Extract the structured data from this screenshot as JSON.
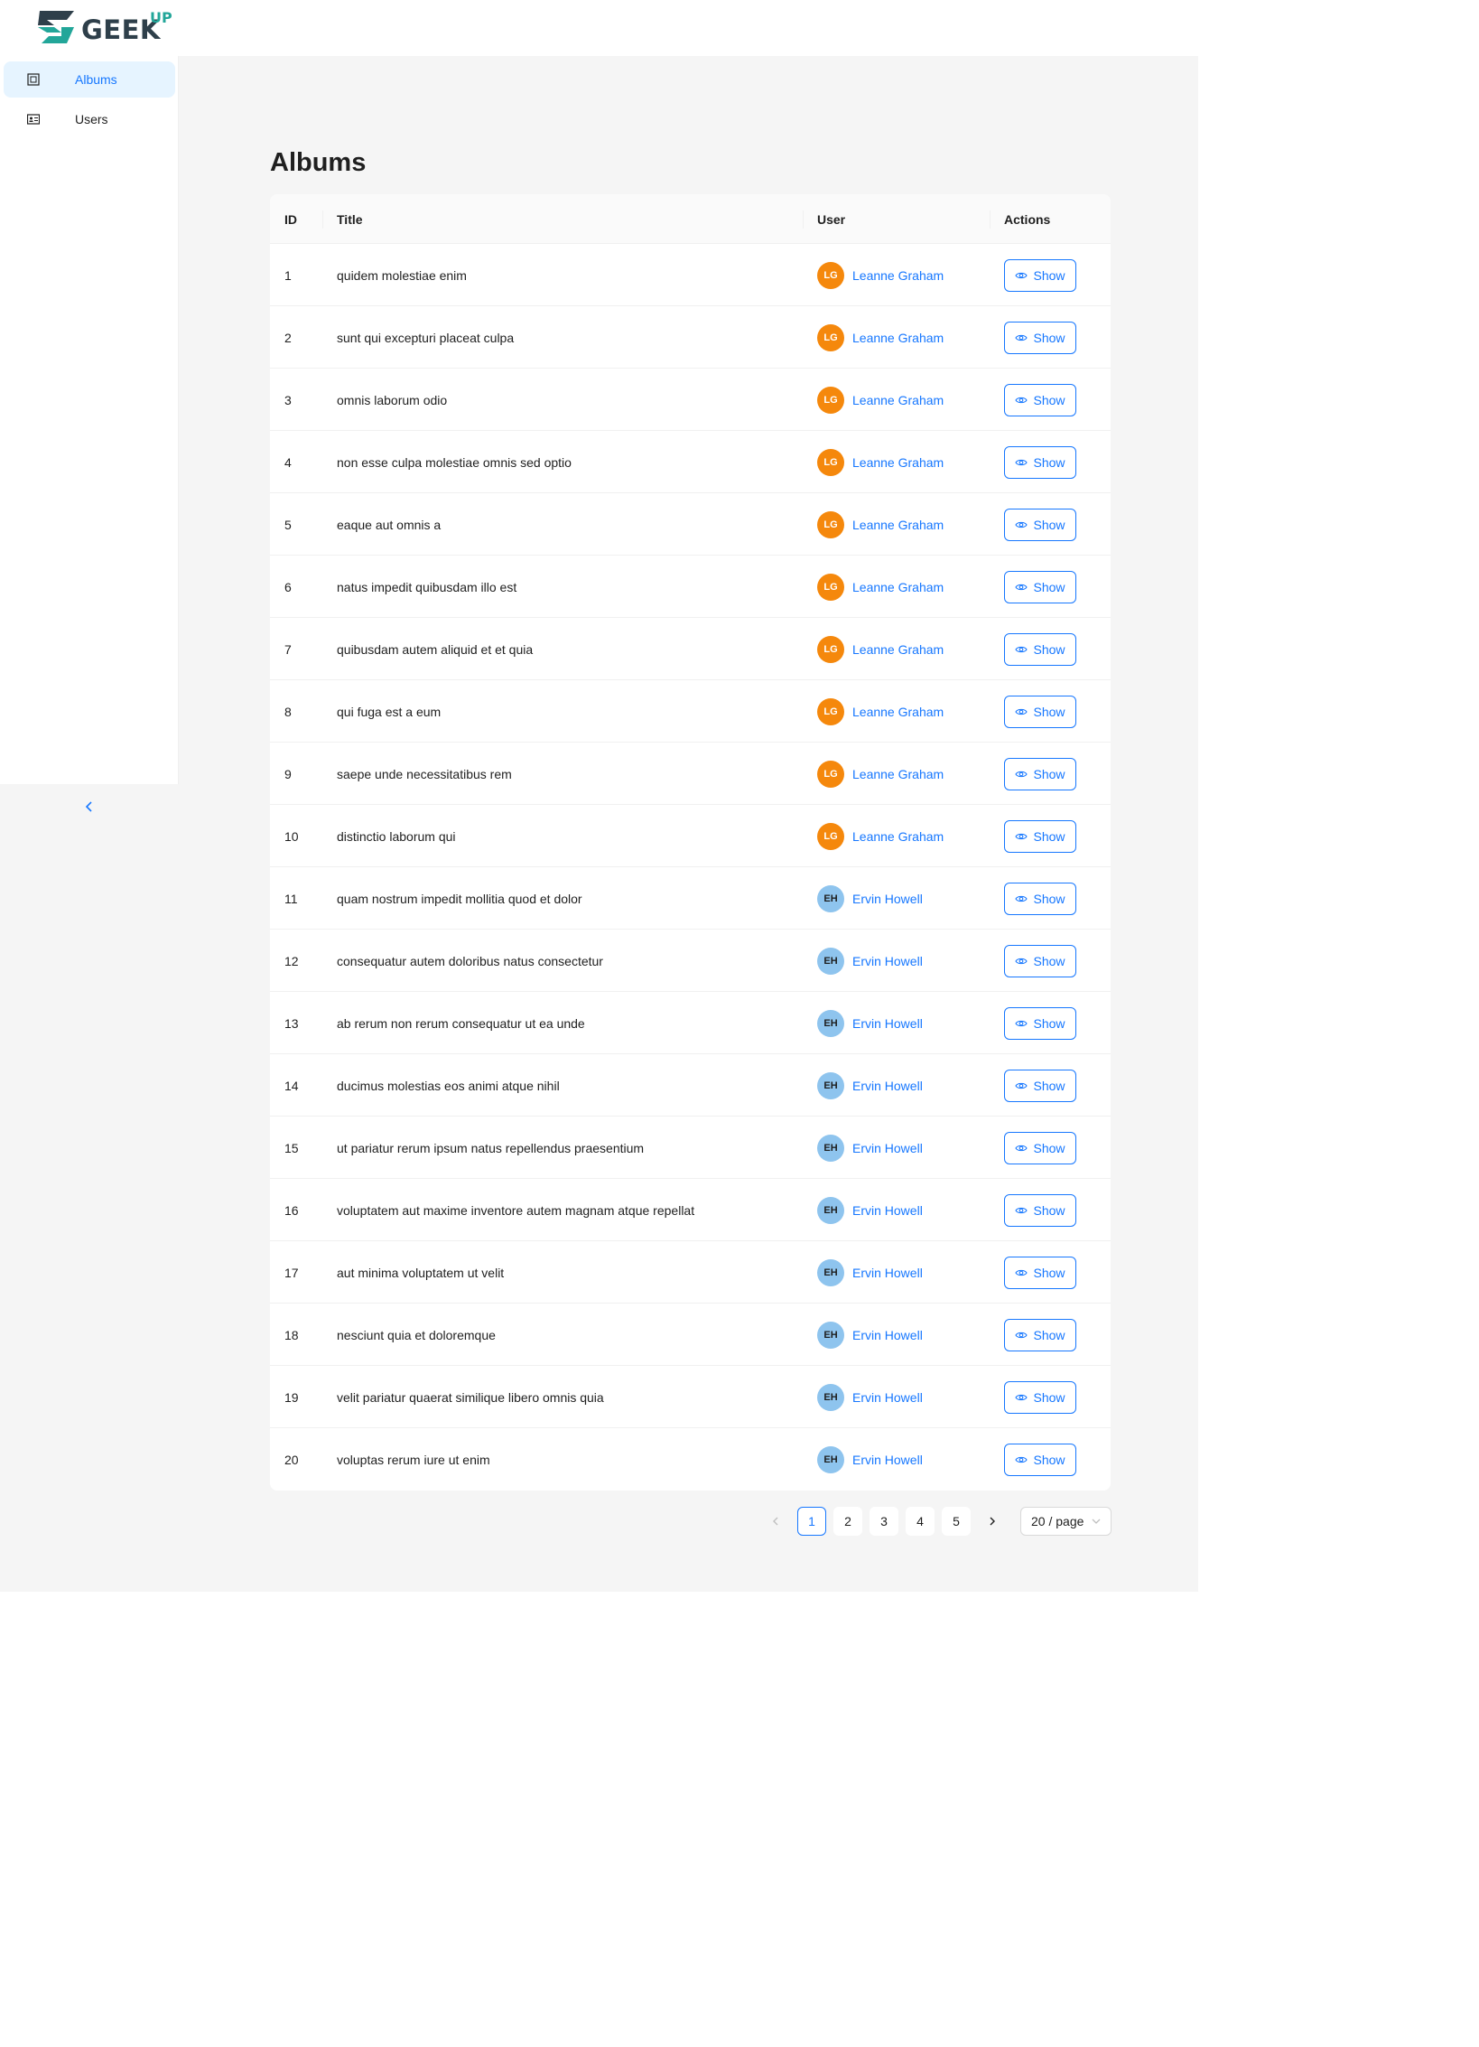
{
  "header": {
    "logo_main": "GEEK",
    "logo_sup": "UP",
    "logo_icon": "geekup-logo-icon"
  },
  "sidebar": {
    "items": [
      {
        "label": "Albums",
        "icon": "album-icon",
        "active": true
      },
      {
        "label": "Users",
        "icon": "id-card-icon",
        "active": false
      }
    ],
    "collapse_icon": "chevron-left-icon"
  },
  "page": {
    "title": "Albums"
  },
  "table": {
    "columns": [
      "ID",
      "Title",
      "User",
      "Actions"
    ],
    "show_label": "Show",
    "show_icon": "eye-icon",
    "rows": [
      {
        "id": "1",
        "title": "quidem molestiae enim",
        "initials": "LG",
        "user": "Leanne Graham"
      },
      {
        "id": "2",
        "title": "sunt qui excepturi placeat culpa",
        "initials": "LG",
        "user": "Leanne Graham"
      },
      {
        "id": "3",
        "title": "omnis laborum odio",
        "initials": "LG",
        "user": "Leanne Graham"
      },
      {
        "id": "4",
        "title": "non esse culpa molestiae omnis sed optio",
        "initials": "LG",
        "user": "Leanne Graham"
      },
      {
        "id": "5",
        "title": "eaque aut omnis a",
        "initials": "LG",
        "user": "Leanne Graham"
      },
      {
        "id": "6",
        "title": "natus impedit quibusdam illo est",
        "initials": "LG",
        "user": "Leanne Graham"
      },
      {
        "id": "7",
        "title": "quibusdam autem aliquid et et quia",
        "initials": "LG",
        "user": "Leanne Graham"
      },
      {
        "id": "8",
        "title": "qui fuga est a eum",
        "initials": "LG",
        "user": "Leanne Graham"
      },
      {
        "id": "9",
        "title": "saepe unde necessitatibus rem",
        "initials": "LG",
        "user": "Leanne Graham"
      },
      {
        "id": "10",
        "title": "distinctio laborum qui",
        "initials": "LG",
        "user": "Leanne Graham"
      },
      {
        "id": "11",
        "title": "quam nostrum impedit mollitia quod et dolor",
        "initials": "EH",
        "user": "Ervin Howell"
      },
      {
        "id": "12",
        "title": "consequatur autem doloribus natus consectetur",
        "initials": "EH",
        "user": "Ervin Howell"
      },
      {
        "id": "13",
        "title": "ab rerum non rerum consequatur ut ea unde",
        "initials": "EH",
        "user": "Ervin Howell"
      },
      {
        "id": "14",
        "title": "ducimus molestias eos animi atque nihil",
        "initials": "EH",
        "user": "Ervin Howell"
      },
      {
        "id": "15",
        "title": "ut pariatur rerum ipsum natus repellendus praesentium",
        "initials": "EH",
        "user": "Ervin Howell"
      },
      {
        "id": "16",
        "title": "voluptatem aut maxime inventore autem magnam atque repellat",
        "initials": "EH",
        "user": "Ervin Howell"
      },
      {
        "id": "17",
        "title": "aut minima voluptatem ut velit",
        "initials": "EH",
        "user": "Ervin Howell"
      },
      {
        "id": "18",
        "title": "nesciunt quia et doloremque",
        "initials": "EH",
        "user": "Ervin Howell"
      },
      {
        "id": "19",
        "title": "velit pariatur quaerat similique libero omnis quia",
        "initials": "EH",
        "user": "Ervin Howell"
      },
      {
        "id": "20",
        "title": "voluptas rerum iure ut enim",
        "initials": "EH",
        "user": "Ervin Howell"
      }
    ]
  },
  "pagination": {
    "pages": [
      "1",
      "2",
      "3",
      "4",
      "5"
    ],
    "current": "1",
    "prev_icon": "chevron-left-icon",
    "next_icon": "chevron-right-icon",
    "page_size": "20 / page",
    "page_size_icon": "chevron-down-icon"
  },
  "colors": {
    "accent": "#1677ff",
    "avatar_lg": "#f5880c",
    "avatar_eh": "#8ec4ee",
    "logo_dark": "#2e3f4a",
    "logo_teal": "#22a699"
  }
}
